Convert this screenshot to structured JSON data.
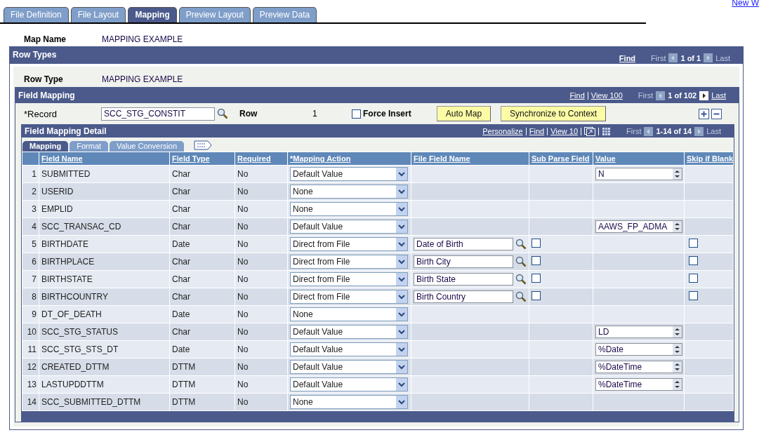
{
  "tabs": [
    {
      "label": "File Definition",
      "selected": false
    },
    {
      "label": "File Layout",
      "selected": false
    },
    {
      "label": "Mapping",
      "selected": true
    },
    {
      "label": "Preview Layout",
      "selected": false
    },
    {
      "label": "Preview Data",
      "selected": false
    }
  ],
  "corner_link": "New W",
  "map_name": {
    "label": "Map Name",
    "value": "MAPPING EXAMPLE"
  },
  "row_types": {
    "title": "Row Types",
    "find": "Find",
    "first": "First",
    "count": "1 of 1",
    "last": "Last",
    "row_type": {
      "label": "Row Type",
      "value": "MAPPING EXAMPLE"
    },
    "field_mapping": {
      "title": "Field Mapping",
      "find": "Find",
      "view": "View 100",
      "first": "First",
      "count": "1 of 102",
      "last": "Last",
      "record": {
        "label": "*Record",
        "value": "SCC_STG_CONSTIT"
      },
      "row": {
        "label": "Row",
        "value": "1"
      },
      "force_insert": {
        "label": "Force Insert",
        "checked": false
      },
      "buttons": [
        "Auto Map",
        "Synchronize to Context"
      ],
      "detail": {
        "title": "Field Mapping Detail",
        "links": [
          "Personalize",
          "Find",
          "View 10"
        ],
        "first": "First",
        "count": "1-14 of 14",
        "last": "Last",
        "subtabs": [
          {
            "label": "Mapping",
            "selected": true
          },
          {
            "label": "Format",
            "selected": false
          },
          {
            "label": "Value Conversion",
            "selected": false
          }
        ],
        "columns": [
          "Field Name",
          "Field Type",
          "Required",
          "*Mapping Action",
          "File Field Name",
          "Sub Parse Field",
          "Value",
          "Skip if Blank"
        ],
        "rows": [
          {
            "num": "1",
            "name": "SUBMITTED",
            "type": "Char",
            "required": "No",
            "action": "Default Value",
            "value": "N"
          },
          {
            "num": "2",
            "name": "USERID",
            "type": "Char",
            "required": "No",
            "action": "None"
          },
          {
            "num": "3",
            "name": "EMPLID",
            "type": "Char",
            "required": "No",
            "action": "None"
          },
          {
            "num": "4",
            "name": "SCC_TRANSAC_CD",
            "type": "Char",
            "required": "No",
            "action": "Default Value",
            "value": "AAWS_FP_ADMA"
          },
          {
            "num": "5",
            "name": "BIRTHDATE",
            "type": "Date",
            "required": "No",
            "action": "Direct from File",
            "file_field": "Date of Birth",
            "sub_parse": {
              "checked": false
            },
            "skip_if_blank": {
              "checked": false
            }
          },
          {
            "num": "6",
            "name": "BIRTHPLACE",
            "type": "Char",
            "required": "No",
            "action": "Direct from File",
            "file_field": "Birth City",
            "sub_parse": {
              "checked": false
            },
            "skip_if_blank": {
              "checked": false
            }
          },
          {
            "num": "7",
            "name": "BIRTHSTATE",
            "type": "Char",
            "required": "No",
            "action": "Direct from File",
            "file_field": "Birth State",
            "sub_parse": {
              "checked": false
            },
            "skip_if_blank": {
              "checked": false
            }
          },
          {
            "num": "8",
            "name": "BIRTHCOUNTRY",
            "type": "Char",
            "required": "No",
            "action": "Direct from File",
            "file_field": "Birth Country",
            "sub_parse": {
              "checked": false
            },
            "skip_if_blank": {
              "checked": false
            }
          },
          {
            "num": "9",
            "name": "DT_OF_DEATH",
            "type": "Date",
            "required": "No",
            "action": "None"
          },
          {
            "num": "10",
            "name": "SCC_STG_STATUS",
            "type": "Char",
            "required": "No",
            "action": "Default Value",
            "value": "LD"
          },
          {
            "num": "11",
            "name": "SCC_STG_STS_DT",
            "type": "Date",
            "required": "No",
            "action": "Default Value",
            "value": "%Date"
          },
          {
            "num": "12",
            "name": "CREATED_DTTM",
            "type": "DTTM",
            "required": "No",
            "action": "Default Value",
            "value": "%DateTime"
          },
          {
            "num": "13",
            "name": "LASTUPDDTTM",
            "type": "DTTM",
            "required": "No",
            "action": "Default Value",
            "value": "%DateTime"
          },
          {
            "num": "14",
            "name": "SCC_SUBMITTED_DTTM",
            "type": "DTTM",
            "required": "No",
            "action": "None"
          }
        ]
      }
    }
  }
}
